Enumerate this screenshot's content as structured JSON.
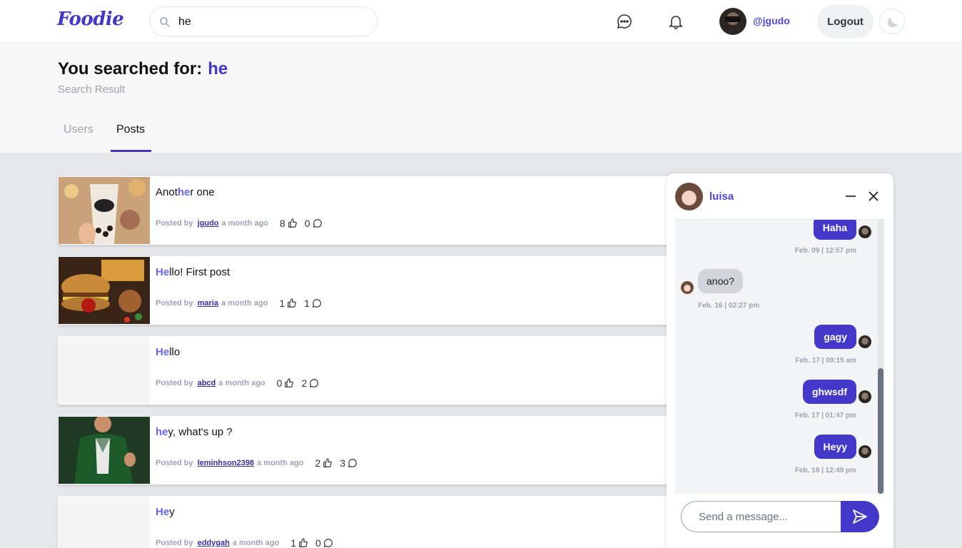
{
  "nav": {
    "logo": "Foodie",
    "search_value": "he",
    "username": "@jgudo",
    "logout_label": "Logout"
  },
  "header": {
    "title": "You searched for:",
    "query": "he",
    "subtitle": "Search Result",
    "tabs": [
      {
        "label": "Users",
        "active": false
      },
      {
        "label": "Posts",
        "active": true
      }
    ]
  },
  "posts": [
    {
      "title_pre": "Anot",
      "title_hl": "he",
      "title_post": "r one",
      "posted_by": "Posted by",
      "author": "jgudo",
      "time": "a month ago",
      "likes": "8",
      "comments": "0"
    },
    {
      "title_pre": "",
      "title_hl": "He",
      "title_post": "llo! First post",
      "posted_by": "Posted by",
      "author": "maria",
      "time": "a month ago",
      "likes": "1",
      "comments": "1"
    },
    {
      "title_pre": "",
      "title_hl": "He",
      "title_post": "llo",
      "posted_by": "Posted by",
      "author": "abcd",
      "time": "a month ago",
      "likes": "0",
      "comments": "2"
    },
    {
      "title_pre": "",
      "title_hl": "he",
      "title_post": "y, what's up ?",
      "posted_by": "Posted by",
      "author": "leminhson2398",
      "time": "a month ago",
      "likes": "2",
      "comments": "3"
    },
    {
      "title_pre": "",
      "title_hl": "He",
      "title_post": "y",
      "posted_by": "Posted by",
      "author": "eddygah",
      "time": "a month ago",
      "likes": "1",
      "comments": "0"
    }
  ],
  "chat": {
    "name": "luisa",
    "messages": [
      {
        "text": "Haha",
        "from": "me",
        "time": "Feb. 09 | 12:57 pm"
      },
      {
        "text": "anoo?",
        "from": "them",
        "time": "Feb. 16 | 02:27 pm"
      },
      {
        "text": "gagy",
        "from": "me",
        "time": "Feb. 17 | 09:15 am"
      },
      {
        "text": "ghwsdf",
        "from": "me",
        "time": "Feb. 17 | 01:47 pm"
      },
      {
        "text": "Heyy",
        "from": "me",
        "time": "Feb. 18 | 12:49 pm"
      }
    ],
    "input_placeholder": "Send a message..."
  },
  "colors": {
    "accent": "#4338ca",
    "highlight": "#6366f1"
  }
}
